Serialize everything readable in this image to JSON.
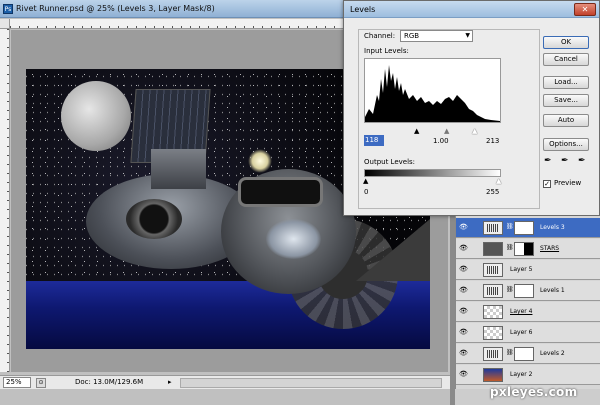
{
  "document": {
    "title": "Rivet Runner.psd @ 25% (Levels 3, Layer Mask/8)",
    "zoom": "25%",
    "doc_size": "Doc: 13.0M/129.6M"
  },
  "levels_dialog": {
    "title": "Levels",
    "channel_label": "Channel:",
    "channel_value": "RGB",
    "input_levels_label": "Input Levels:",
    "input_black": "118",
    "input_gamma": "1.00",
    "input_white": "213",
    "output_levels_label": "Output Levels:",
    "output_black": "0",
    "output_white": "255",
    "buttons": {
      "ok": "OK",
      "cancel": "Cancel",
      "load": "Load...",
      "save": "Save...",
      "auto": "Auto",
      "options": "Options..."
    },
    "preview_label": "Preview",
    "preview_checked": true
  },
  "layers": [
    {
      "name": "Levels 3",
      "type": "adjustment",
      "selected": true
    },
    {
      "name": "STARS",
      "type": "dark"
    },
    {
      "name": "Layer 5",
      "type": "adjustment-clip"
    },
    {
      "name": "Levels 1",
      "type": "adjustment"
    },
    {
      "name": "Layer 4",
      "type": "pixel"
    },
    {
      "name": "Layer 6",
      "type": "pixel"
    },
    {
      "name": "Levels 2",
      "type": "adjustment"
    },
    {
      "name": "Layer 2",
      "type": "gradient"
    }
  ],
  "watermark": "pxleyes.com",
  "colors": {
    "selection": "#3d6bc2",
    "close_button": "#c1402a"
  },
  "icons": {
    "visibility": "eye-icon",
    "eyedropper": "eyedropper-icon",
    "close": "close-icon"
  }
}
